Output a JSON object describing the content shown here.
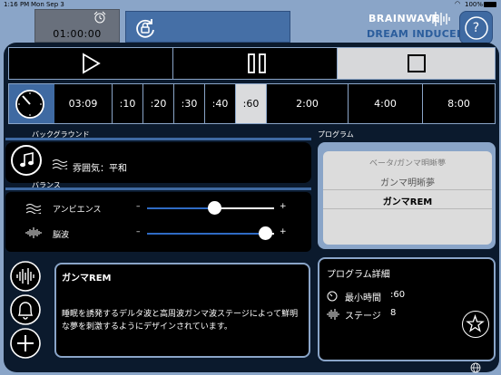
{
  "status_bar": {
    "time": "1:16 PM",
    "date": "Mon Sep 3",
    "battery": "100%"
  },
  "header": {
    "timer": "01:00:00",
    "brand_line1": "BRAINWAVE",
    "brand_line2": "DREAM INDUCER",
    "help_label": "?"
  },
  "durations": [
    {
      "label": "03:09",
      "selected": false
    },
    {
      "label": ":10",
      "selected": false
    },
    {
      "label": ":20",
      "selected": false
    },
    {
      "label": ":30",
      "selected": false
    },
    {
      "label": ":40",
      "selected": false
    },
    {
      "label": ":60",
      "selected": true
    },
    {
      "label": "2:00",
      "selected": false
    },
    {
      "label": "4:00",
      "selected": false
    },
    {
      "label": "8:00",
      "selected": false
    }
  ],
  "background_section": {
    "header": "バックグラウンド",
    "value": "雰囲気：平和"
  },
  "balance_section": {
    "header": "バランス",
    "sliders": [
      {
        "label": "アンビエンス",
        "value": 0.53,
        "minus": "–",
        "plus": "+"
      },
      {
        "label": "脳波",
        "value": 0.93,
        "minus": "–",
        "plus": "+"
      }
    ]
  },
  "program_section": {
    "header": "プログラム",
    "items": [
      "ベータ/ガンマ明晰夢",
      "ガンマ明晰夢",
      "ガンマREM"
    ],
    "selected": "ガンマREM"
  },
  "description": {
    "title": "ガンマREM",
    "body": "睡眠を誘発するデルタ波と高周波ガンマ波ステージによって鮮明な夢を刺激するようにデザインされています。"
  },
  "details": {
    "title": "プログラム詳細",
    "min_time_label": "最小時間",
    "min_time_value": ":60",
    "stages_label": "ステージ",
    "stages_value": "8"
  },
  "colors": {
    "accent_blue": "#3f6aa2",
    "panel_dark": "#0b1a2d",
    "frame": "#8aa5c8",
    "slider_fill": "#2f6bc4"
  },
  "icons": [
    "alarm-clock-icon",
    "lock-rotation-icon",
    "waveform-icon",
    "help-icon",
    "play-icon",
    "pause-icon",
    "stop-icon",
    "stopwatch-icon",
    "music-note-icon",
    "waves-icon",
    "bell-icon",
    "plus-icon",
    "star-icon",
    "globe-icon"
  ]
}
